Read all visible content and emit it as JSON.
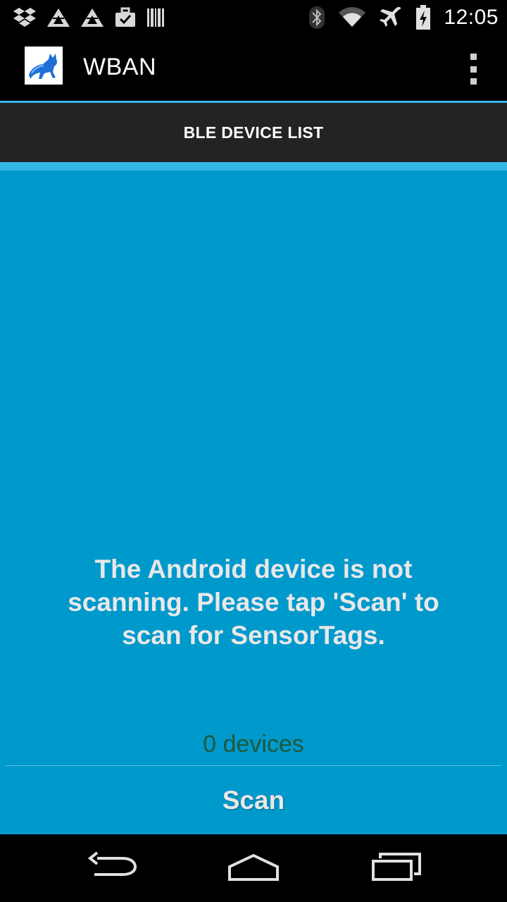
{
  "status_bar": {
    "time": "12:05",
    "notification_icons": [
      "dropbox-icon",
      "triangle-app-icon",
      "triangle-app-icon",
      "briefcase-check-icon",
      "barcode-icon"
    ],
    "system_icons": [
      "bluetooth-icon",
      "wifi-icon",
      "airplane-mode-icon",
      "battery-charging-icon"
    ]
  },
  "action_bar": {
    "title": "WBAN",
    "logo": "cat-logo",
    "overflow_icon": "overflow-menu-icon"
  },
  "tabs": [
    {
      "label": "BLE DEVICE LIST",
      "selected": true
    }
  ],
  "main": {
    "status_message": "The Android device is not scanning. Please tap 'Scan' to scan for SensorTags.",
    "device_count": "0 devices",
    "scan_label": "Scan"
  },
  "nav_bar": {
    "buttons": [
      "back-icon",
      "home-icon",
      "recent-apps-icon"
    ]
  },
  "colors": {
    "accent": "#33b5e5",
    "content_background": "#0099cc",
    "tab_background": "#232323",
    "device_count_text": "#1d5a3c"
  }
}
